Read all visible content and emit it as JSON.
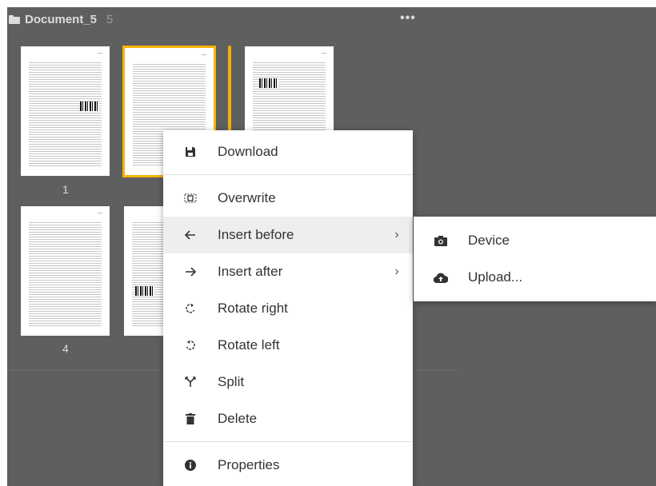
{
  "folder": {
    "title": "Document_5",
    "count": "5",
    "icon": "folder-icon",
    "more_icon": "more-horiz-icon"
  },
  "pages": [
    {
      "number": "1"
    },
    {
      "number": ""
    },
    {
      "number": ""
    },
    {
      "number": "4"
    },
    {
      "number": ""
    }
  ],
  "accent_color": "#f5b400",
  "context_menu": {
    "items": [
      {
        "label": "Download",
        "icon": "floppy-icon"
      },
      {
        "label": "Overwrite",
        "icon": "overwrite-icon"
      },
      {
        "label": "Insert before",
        "icon": "arrow-left-icon",
        "submenu": true
      },
      {
        "label": "Insert after",
        "icon": "arrow-right-icon",
        "submenu": true
      },
      {
        "label": "Rotate right",
        "icon": "rotate-right-icon"
      },
      {
        "label": "Rotate left",
        "icon": "rotate-left-icon"
      },
      {
        "label": "Split",
        "icon": "split-icon"
      },
      {
        "label": "Delete",
        "icon": "trash-icon"
      },
      {
        "label": "Properties",
        "icon": "info-icon"
      }
    ],
    "chevron": "›"
  },
  "submenu": {
    "items": [
      {
        "label": "Device",
        "icon": "camera-icon"
      },
      {
        "label": "Upload...",
        "icon": "cloud-upload-icon"
      }
    ]
  }
}
